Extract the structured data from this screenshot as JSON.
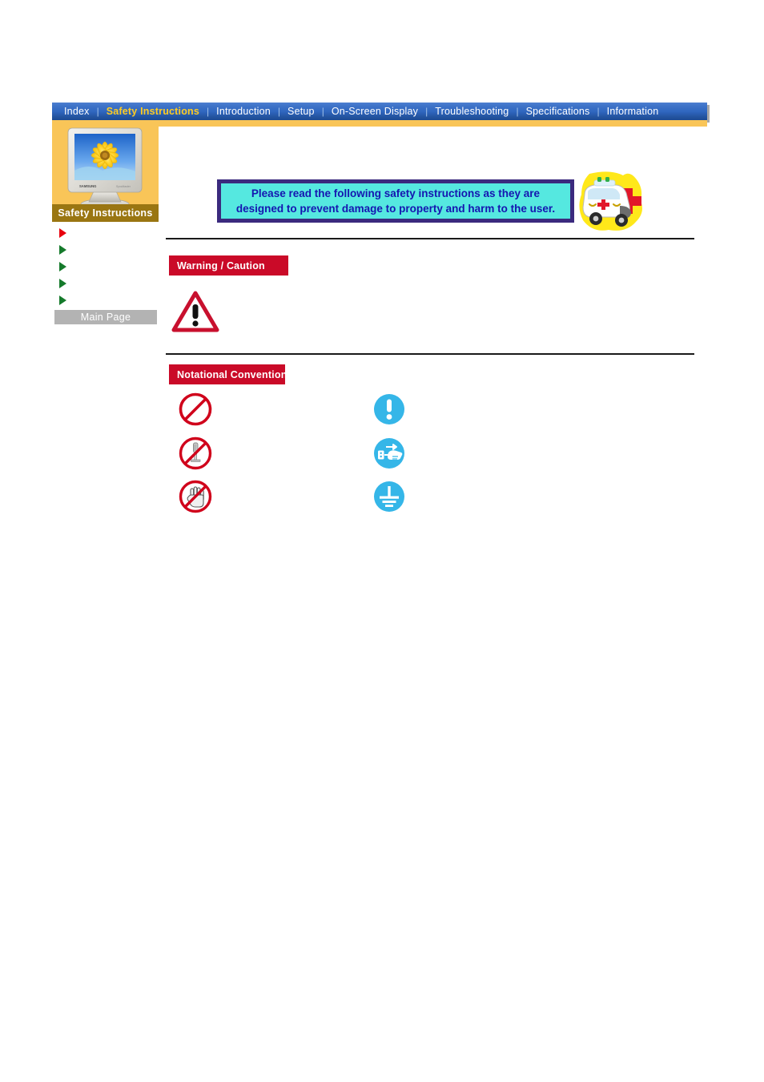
{
  "nav": {
    "items": [
      {
        "label": "Index",
        "active": false
      },
      {
        "label": "Safety Instructions",
        "active": true
      },
      {
        "label": "Introduction",
        "active": false
      },
      {
        "label": "Setup",
        "active": false
      },
      {
        "label": "On-Screen Display",
        "active": false
      },
      {
        "label": "Troubleshooting",
        "active": false
      },
      {
        "label": "Specifications",
        "active": false
      },
      {
        "label": "Information",
        "active": false
      }
    ],
    "separator": "|",
    "active_color": "#ffcc22",
    "text_color": "#ffffff",
    "bar_color": "#2f66bf"
  },
  "sidebar": {
    "title": "Safety Instructions",
    "thumbnail_icon": "monitor-sunflower-icon",
    "links": [
      {
        "label": "",
        "bullet": "red"
      },
      {
        "label": "",
        "bullet": "green"
      },
      {
        "label": "",
        "bullet": "green"
      },
      {
        "label": "",
        "bullet": "green"
      },
      {
        "label": "",
        "bullet": "green"
      }
    ],
    "main_page_label": "Main Page",
    "panel_color": "#f9c558",
    "title_bar_color": "#9a7612",
    "main_page_color": "#b3b3b3"
  },
  "banner": {
    "text": "Please read the following safety instructions as they are\ndesigned to prevent damage to property and harm to the user.",
    "fill_color": "#55e8e0",
    "border_color": "#3b2a7e",
    "text_color": "#1515b0",
    "side_icon": "ambulance-icon"
  },
  "sections": [
    {
      "heading": "Warning / Caution",
      "chip_color": "#ca0a28",
      "icons": [
        {
          "name": "warning-triangle-icon",
          "caption": ""
        }
      ]
    },
    {
      "heading": "Notational Conventions",
      "chip_color": "#ca0a28",
      "icons": [
        {
          "name": "prohibition-icon",
          "caption": ""
        },
        {
          "name": "no-disassembly-icon",
          "caption": ""
        },
        {
          "name": "do-not-touch-icon",
          "caption": ""
        },
        {
          "name": "caution-exclamation-icon",
          "caption": ""
        },
        {
          "name": "unplug-power-icon",
          "caption": ""
        },
        {
          "name": "ground-earth-icon",
          "caption": ""
        }
      ]
    }
  ],
  "colors": {
    "prohibition_red": "#d0021b",
    "mandatory_blue": "#35b6e8",
    "rule_color": "#1a1a1a"
  }
}
